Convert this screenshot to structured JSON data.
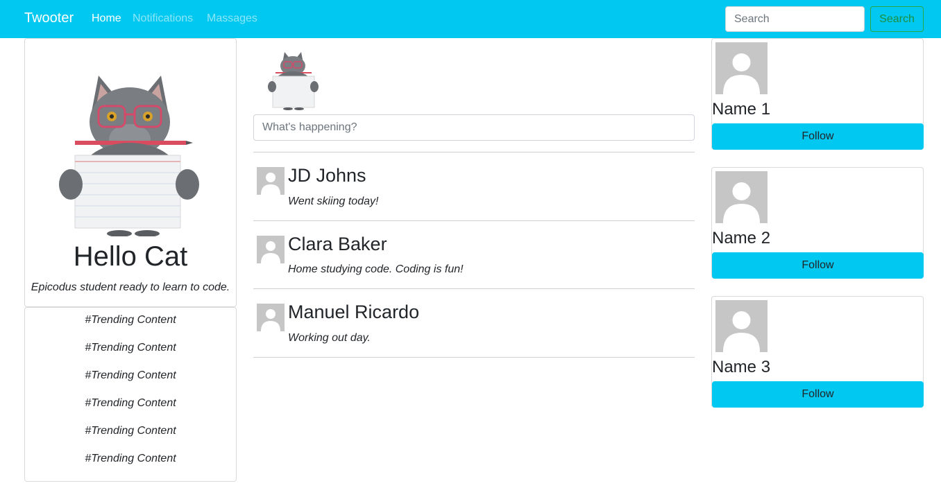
{
  "navbar": {
    "brand": "Twooter",
    "links": [
      "Home",
      "Notifications",
      "Massages"
    ],
    "search_placeholder": "Search",
    "search_button": "Search",
    "accent_color": "#00c8f0"
  },
  "profile": {
    "name": "Hello Cat",
    "bio": "Epicodus student ready to learn to code.",
    "image_icon": "cat-photo"
  },
  "trending": [
    "#Trending Content",
    "#Trending Content",
    "#Trending Content",
    "#Trending Content",
    "#Trending Content",
    "#Trending Content"
  ],
  "compose": {
    "placeholder": "What's happening?"
  },
  "posts": [
    {
      "name": "JD Johns",
      "text": "Went skiing today!"
    },
    {
      "name": "Clara Baker",
      "text": "Home studying code. Coding is fun!"
    },
    {
      "name": "Manuel Ricardo",
      "text": "Working out day."
    }
  ],
  "suggestions": [
    {
      "name": "Name 1",
      "button": "Follow"
    },
    {
      "name": "Name 2",
      "button": "Follow"
    },
    {
      "name": "Name 3",
      "button": "Follow"
    }
  ]
}
